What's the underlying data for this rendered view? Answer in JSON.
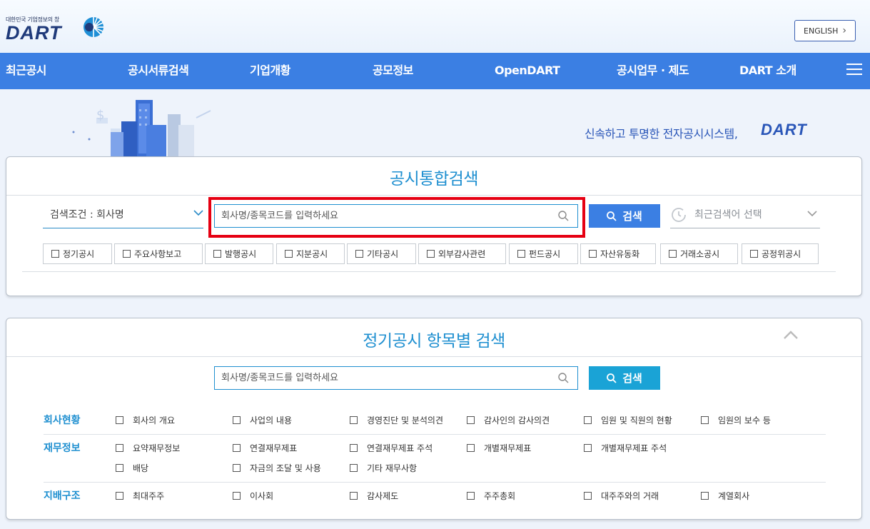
{
  "header": {
    "logo_tagline": "대한민국 기업정보의 창",
    "logo_text": "DART",
    "english_button": "ENGLISH"
  },
  "nav": {
    "items": [
      "최근공시",
      "공시서류검색",
      "기업개황",
      "공모정보",
      "OpenDART",
      "공시업무 · 제도",
      "DART 소개"
    ]
  },
  "hero": {
    "slogan": "신속하고 투명한 전자공시시스템,",
    "logo_text": "DART"
  },
  "integrated_search": {
    "title": "공시통합검색",
    "condition_select": "검색조건 : 회사명",
    "input_placeholder": "회사명/종목코드를 입력하세요",
    "search_button": "검색",
    "recent_select": "최근검색어 선택",
    "filters": [
      "정기공시",
      "주요사항보고",
      "발행공시",
      "지분공시",
      "기타공시",
      "외부감사관련",
      "펀드공시",
      "자산유동화",
      "거래소공시",
      "공정위공시"
    ]
  },
  "periodic_search": {
    "title": "정기공시 항목별 검색",
    "input_placeholder": "회사명/종목코드를 입력하세요",
    "search_button": "검색",
    "categories": [
      {
        "title": "회사현황",
        "options": [
          "회사의 개요",
          "사업의 내용",
          "경영진단 및 분석의견",
          "감사인의 감사의견",
          "임원 및 직원의 현황",
          "임원의 보수 등"
        ]
      },
      {
        "title": "재무정보",
        "options": [
          "요약재무정보",
          "연결재무제표",
          "연결재무제표 주석",
          "개별재무제표",
          "개별재무제표 주석",
          "배당",
          "자금의 조달 및 사용",
          "기타 재무사항"
        ]
      },
      {
        "title": "지배구조",
        "options": [
          "최대주주",
          "이사회",
          "감사제도",
          "주주총회",
          "대주주와의 거래",
          "계열회사"
        ]
      }
    ]
  },
  "colors": {
    "nav_bg": "#3b7fe3",
    "accent": "#1e8fd0",
    "button_primary": "#3b7fe3",
    "button_secondary": "#1aa3d6",
    "highlight": "#e60012"
  }
}
